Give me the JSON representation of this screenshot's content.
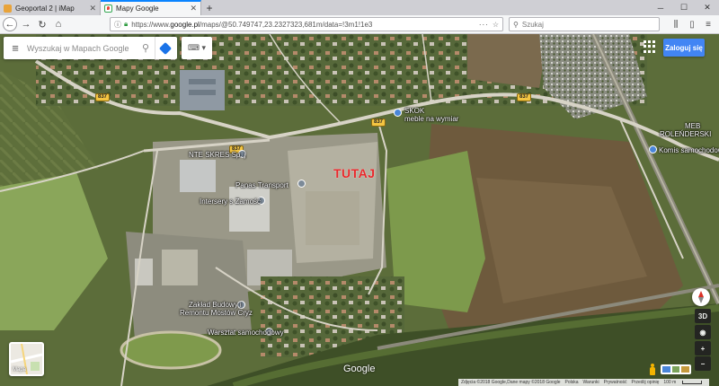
{
  "browser": {
    "tabs": [
      {
        "title": "Geoportal 2 | iMap",
        "active": false
      },
      {
        "title": "Mapy Google",
        "active": true
      }
    ],
    "new_tab_label": "+",
    "url_prefix": "https://www.",
    "url_domain": "google.pl",
    "url_rest": "/maps/@50.749747,23.2327323,681m/data=!3m1!1e3",
    "search_placeholder": "Szukaj",
    "accent": "#0a84ff"
  },
  "map": {
    "search": {
      "placeholder": "Wyszukaj w Mapach Google"
    },
    "sign_in": "Zaloguj się",
    "marker_text": "TUTAJ",
    "marker_color": "#e8282b",
    "places": [
      {
        "label": "SKOK",
        "icon": "shopping-pin"
      },
      {
        "label": "meble na wymiar",
        "icon": "shopping-pin"
      },
      {
        "label": "NTE SKRES Sp. j",
        "icon": "business-pin"
      },
      {
        "label": "Panas Transport",
        "icon": "business-pin"
      },
      {
        "label": "Intersery s Zamość",
        "icon": "business-pin"
      },
      {
        "label": "MEB",
        "icon": "none"
      },
      {
        "label": "ROLEŃDERSKI",
        "icon": "none"
      },
      {
        "label": "Komis samochodowy",
        "icon": "shopping-pin"
      },
      {
        "label": "Zakład Budowy i",
        "icon": "business-pin"
      },
      {
        "label": "Remontu Mostów Cryz",
        "icon": "none"
      },
      {
        "label": "Warsztat samochodowy",
        "icon": "business-pin"
      }
    ],
    "road_numbers": [
      "837",
      "837",
      "837",
      "837"
    ],
    "layer_label": "Mapa",
    "controls": {
      "tilt_3d": "3D",
      "zoom_in": "+",
      "zoom_out": "−"
    },
    "google_logo": "Google",
    "footer": {
      "imagery": "Zdjęcia ©2018 Google,Dane mapy ©2018 Google",
      "country": "Polska",
      "terms": "Warunki",
      "privacy": "Prywatność",
      "feedback": "Prześlij opinię",
      "scale": "100 m"
    }
  }
}
